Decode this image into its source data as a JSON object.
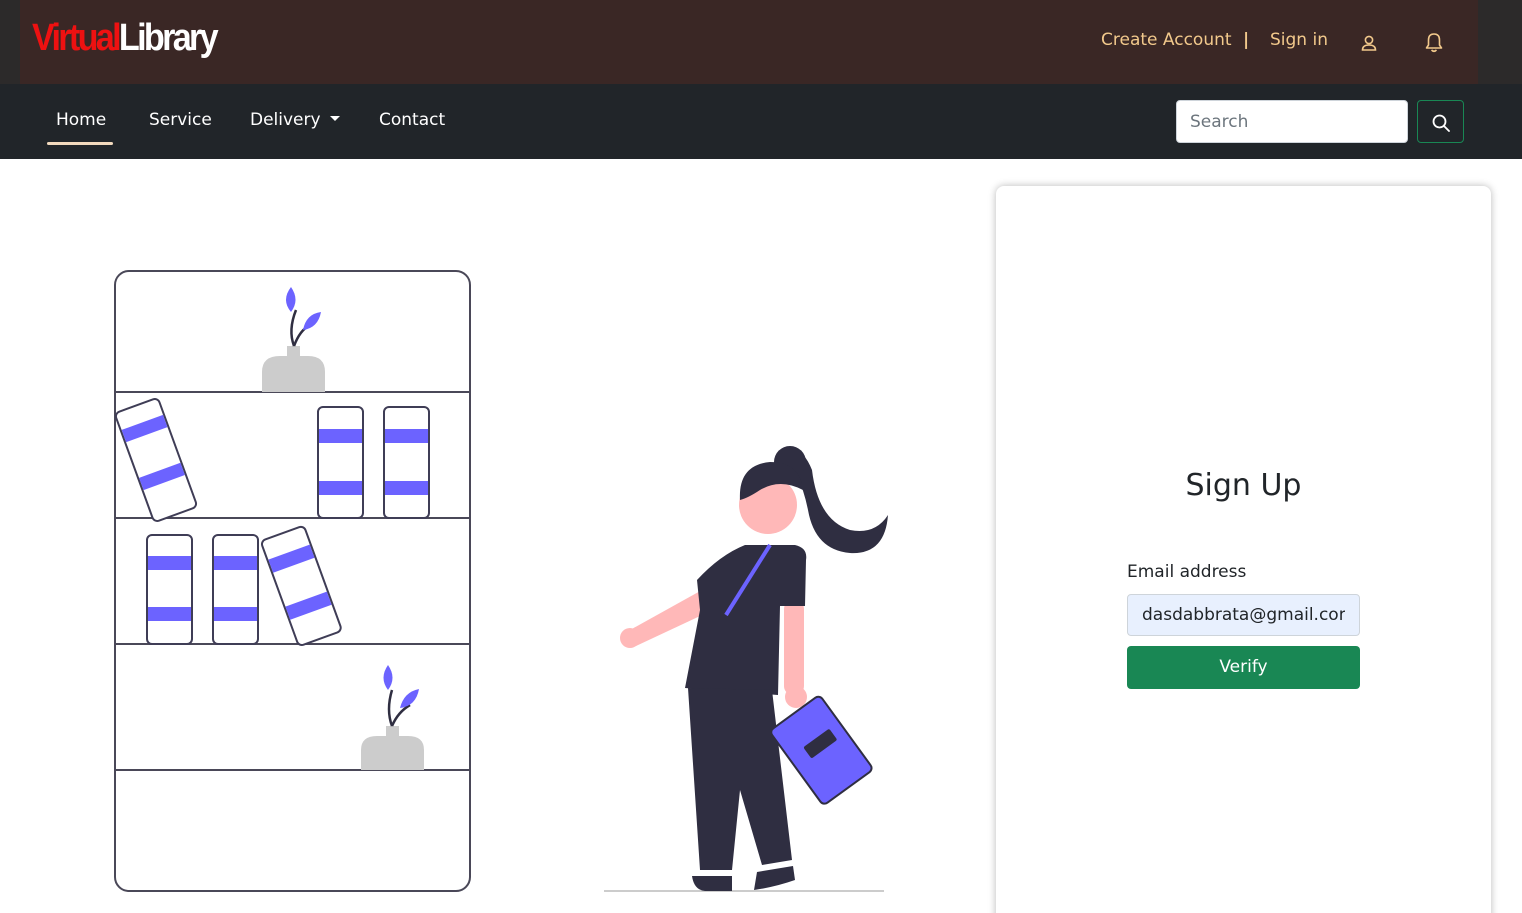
{
  "brand": {
    "logo_part1": "Virtual",
    "logo_part2": "Library"
  },
  "header": {
    "create_account": "Create Account",
    "separator": "|",
    "sign_in": "Sign in",
    "user_icon": "user-icon",
    "notification_icon": "bell-icon"
  },
  "nav": {
    "items": [
      {
        "label": "Home",
        "active": true
      },
      {
        "label": "Service"
      },
      {
        "label": "Delivery",
        "dropdown": true
      },
      {
        "label": "Contact"
      }
    ],
    "search": {
      "placeholder": "Search",
      "button_icon": "search-icon"
    }
  },
  "signup": {
    "title": "Sign Up",
    "email_label": "Email address",
    "email_value": "dasdabbrata@gmail.com",
    "verify_label": "Verify"
  },
  "colors": {
    "topbar": "#3a2725",
    "navbar": "#212529",
    "accent_link": "#f2c98c",
    "success": "#198754",
    "illustration_accent": "#6c63ff",
    "illustration_dark": "#2f2e41",
    "logo_red": "#ee1111"
  }
}
